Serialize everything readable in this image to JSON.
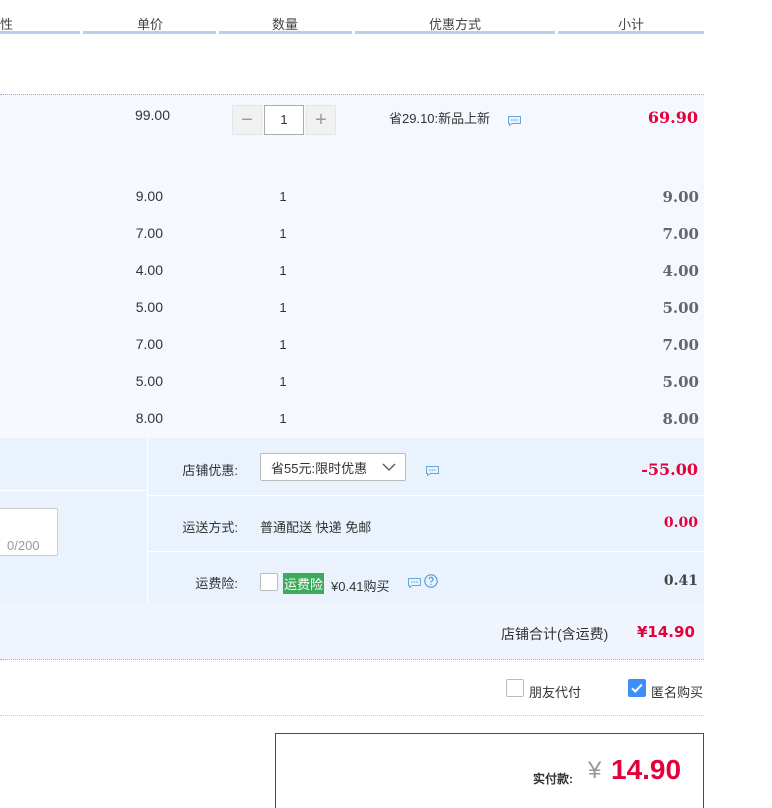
{
  "header": {
    "col_partial": "性",
    "col_price": "单价",
    "col_qty": "数量",
    "col_promo": "优惠方式",
    "col_subtotal": "小计"
  },
  "items": [
    {
      "price": "99.00",
      "qty": "1",
      "promo": "省29.10:新品上新",
      "subtotal": "69.90"
    },
    {
      "price": "9.00",
      "qty": "1",
      "subtotal": "9.00"
    },
    {
      "price": "7.00",
      "qty": "1",
      "subtotal": "7.00"
    },
    {
      "price": "4.00",
      "qty": "1",
      "subtotal": "4.00"
    },
    {
      "price": "5.00",
      "qty": "1",
      "subtotal": "5.00"
    },
    {
      "price": "7.00",
      "qty": "1",
      "subtotal": "7.00"
    },
    {
      "price": "5.00",
      "qty": "1",
      "subtotal": "5.00"
    },
    {
      "price": "8.00",
      "qty": "1",
      "subtotal": "8.00"
    }
  ],
  "stepper": {
    "minus": "−",
    "plus": "+",
    "value": "1"
  },
  "options": {
    "shop_discount_label": "店铺优惠:",
    "shop_discount_value": "省55元:限时优惠",
    "shop_discount_amount": "-55.00",
    "shipping_label": "运送方式:",
    "shipping_value": "普通配送 快递 免邮",
    "shipping_amount": "0.00",
    "insurance_label": "运费险:",
    "insurance_tag": "运费险",
    "insurance_value": "¥0.41购买",
    "insurance_amount": "0.41",
    "message_counter": "0/200"
  },
  "shop_total": {
    "label": "店铺合计(含运费)",
    "value": "¥14.90"
  },
  "pay_options": {
    "friend_pay": "朋友代付",
    "anonymous": "匿名购买"
  },
  "final": {
    "label": "实付款:",
    "currency": "¥",
    "amount": "14.90"
  },
  "colors": {
    "accent_red": "#e4003a",
    "header_line": "#b6d0ee",
    "panel_bg": "#eaf2fd",
    "check_blue": "#3e8ef7",
    "tag_green": "#3daa5a"
  }
}
